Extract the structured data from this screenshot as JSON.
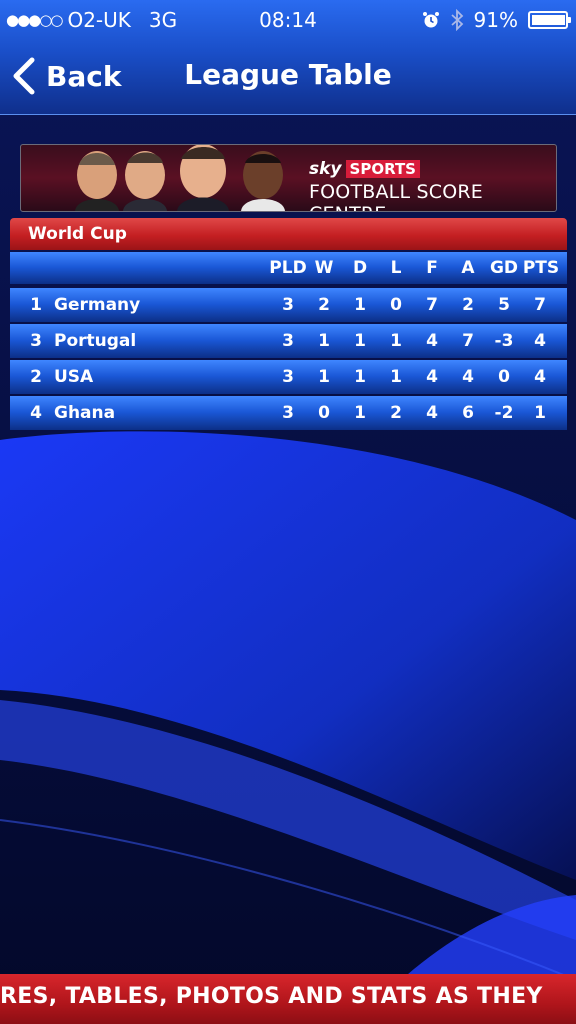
{
  "status": {
    "carrier": "O2-UK",
    "network": "3G",
    "time": "08:14",
    "battery": "91%",
    "battery_level": 0.91,
    "signal_bars": 3
  },
  "nav": {
    "back_label": "Back",
    "title": "League Table"
  },
  "banner": {
    "brand_sky": "sky",
    "brand_sports": "SPORTS",
    "subtitle": "FOOTBALL SCORE CENTRE"
  },
  "league": {
    "name": "World Cup",
    "columns": [
      "PLD",
      "W",
      "D",
      "L",
      "F",
      "A",
      "GD",
      "PTS"
    ],
    "rows": [
      {
        "pos": "1",
        "team": "Germany",
        "stats": [
          "3",
          "2",
          "1",
          "0",
          "7",
          "2",
          "5",
          "7"
        ]
      },
      {
        "pos": "3",
        "team": "Portugal",
        "stats": [
          "3",
          "1",
          "1",
          "1",
          "4",
          "7",
          "-3",
          "4"
        ]
      },
      {
        "pos": "2",
        "team": "USA",
        "stats": [
          "3",
          "1",
          "1",
          "1",
          "4",
          "4",
          "0",
          "4"
        ]
      },
      {
        "pos": "4",
        "team": "Ghana",
        "stats": [
          "3",
          "0",
          "1",
          "2",
          "4",
          "6",
          "-2",
          "1"
        ]
      }
    ]
  },
  "ticker": {
    "text": "RES, TABLES, PHOTOS AND STATS AS THEY"
  },
  "colors": {
    "accent_red": "#c41f22",
    "row_blue": "#1a57d6",
    "nav_blue": "#1a4fc9"
  }
}
